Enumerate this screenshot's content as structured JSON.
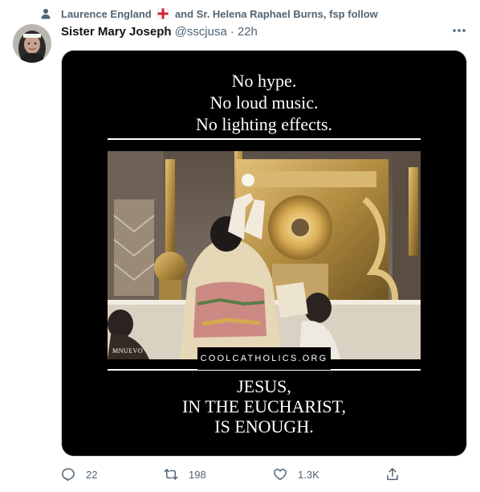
{
  "social_context": {
    "text_before_flag": "Laurence England",
    "text_after_flag": "and Sr. Helena Raphael Burns, fsp follow",
    "icon": "person-icon",
    "flag_icon": "england-flag-icon"
  },
  "tweet": {
    "display_name": "Sister Mary Joseph",
    "handle": "@sscjusa",
    "separator": "·",
    "time": "22h",
    "avatar_icon": "avatar"
  },
  "media": {
    "top_lines": [
      "No hype.",
      "No loud music.",
      "No lighting effects."
    ],
    "bottom_lines": [
      "JESUS,",
      "IN THE EUCHARIST,",
      "IS ENOUGH."
    ],
    "site": "COOLCATHOLICS.ORG",
    "photo_credit": "MNUEVO"
  },
  "actions": {
    "reply_count": "22",
    "retweet_count": "198",
    "like_count": "1.3K",
    "icons": [
      "reply-icon",
      "retweet-icon",
      "like-icon",
      "share-icon"
    ]
  },
  "colors": {
    "secondary_text": "#536471",
    "primary_text": "#0f1419",
    "media_background": "#000000"
  }
}
